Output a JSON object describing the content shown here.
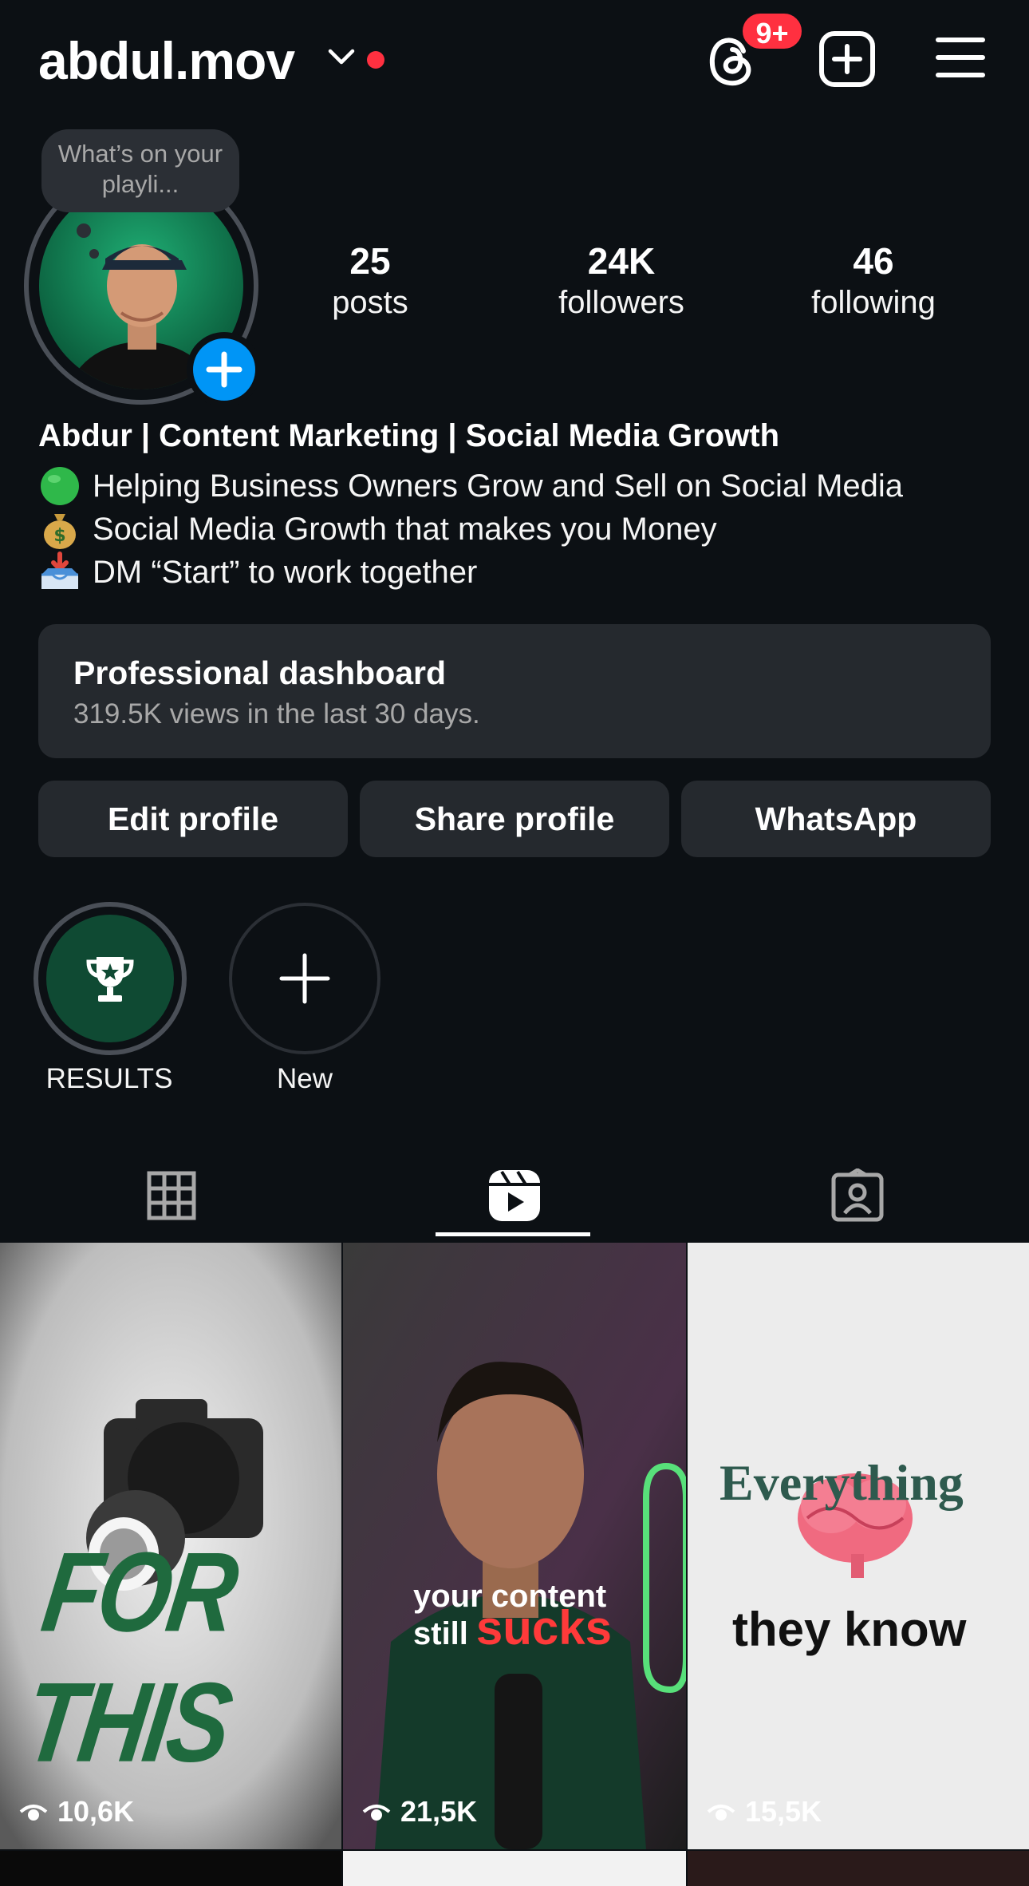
{
  "header": {
    "username": "abdul.mov",
    "threads_badge": "9+"
  },
  "profile": {
    "note": "What’s on your playli...",
    "stats": [
      {
        "value": "25",
        "label": "posts"
      },
      {
        "value": "24K",
        "label": "followers"
      },
      {
        "value": "46",
        "label": "following"
      }
    ],
    "name": "Abdur | Content Marketing | Social Media Growth",
    "bio": [
      {
        "icon": "green-circle-emoji",
        "text": "Helping Business Owners Grow and Sell on Social Media"
      },
      {
        "icon": "money-bag-emoji",
        "text": "Social Media Growth that makes you Money"
      },
      {
        "icon": "inbox-tray-emoji",
        "text": "DM “Start” to work together"
      }
    ]
  },
  "dashboard": {
    "title": "Professional dashboard",
    "subtitle": "319.5K views in the last 30 days."
  },
  "buttons": {
    "edit": "Edit profile",
    "share": "Share profile",
    "whatsapp": "WhatsApp"
  },
  "highlights": [
    {
      "label": "RESULTS",
      "icon": "trophy-icon"
    },
    {
      "label": "New",
      "icon": "plus-icon"
    }
  ],
  "tabs": {
    "active": "reels",
    "items": [
      "grid",
      "reels",
      "tagged"
    ]
  },
  "reels": [
    {
      "views": "10,6K",
      "overlay": "FOR THIS"
    },
    {
      "views": "21,5K",
      "overlay_line1": "your content",
      "overlay_line2": "still",
      "overlay_line3": "sucks"
    },
    {
      "views": "15,5K",
      "overlay_line1": "Everything",
      "overlay_line2": "they know"
    }
  ],
  "colors": {
    "background": "#0c1014",
    "button": "#25292e",
    "accent_blue": "#0095f6",
    "badge_red": "#ff3040"
  }
}
